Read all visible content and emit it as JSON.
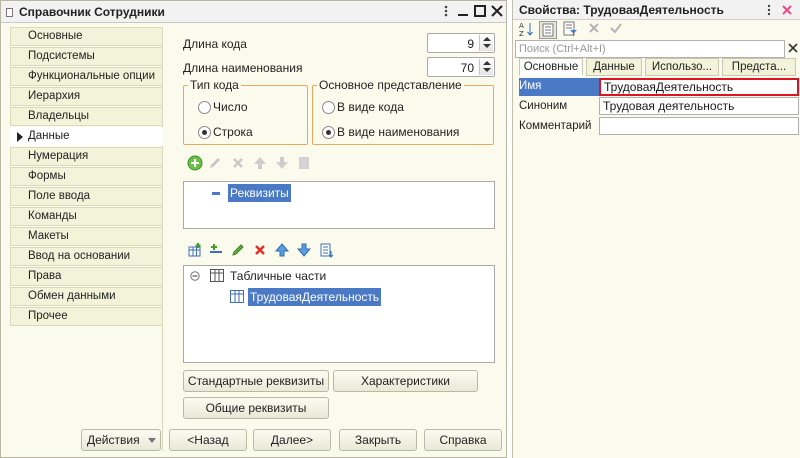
{
  "window": {
    "title": "Справочник Сотрудники"
  },
  "nav": {
    "items": [
      {
        "label": "Основные"
      },
      {
        "label": "Подсистемы"
      },
      {
        "label": "Функциональные опции"
      },
      {
        "label": "Иерархия"
      },
      {
        "label": "Владельцы"
      },
      {
        "label": "Данные"
      },
      {
        "label": "Нумерация"
      },
      {
        "label": "Формы"
      },
      {
        "label": "Поле ввода"
      },
      {
        "label": "Команды"
      },
      {
        "label": "Макеты"
      },
      {
        "label": "Ввод на основании"
      },
      {
        "label": "Права"
      },
      {
        "label": "Обмен данными"
      },
      {
        "label": "Прочее"
      }
    ],
    "active": "Данные"
  },
  "fields": {
    "code_length_label": "Длина кода",
    "code_length_value": "9",
    "name_length_label": "Длина наименования",
    "name_length_value": "70"
  },
  "code_type": {
    "title": "Тип кода",
    "options": [
      "Число",
      "Строка"
    ],
    "selected": "Строка"
  },
  "main_repr": {
    "title": "Основное представление",
    "options": [
      "В виде кода",
      "В виде наименования"
    ],
    "selected": "В виде наименования"
  },
  "attributes_tree": {
    "root": "Реквизиты"
  },
  "tables_tree": {
    "root": "Табличные части",
    "child": "ТрудоваяДеятельность"
  },
  "buttons": {
    "standard_attrs": "Стандартные реквизиты",
    "characteristics": "Характеристики",
    "common_attrs": "Общие реквизиты",
    "actions": "Действия",
    "back": "<Назад",
    "next": "Далее>",
    "close": "Закрыть",
    "help": "Справка"
  },
  "panel": {
    "title": "Свойства: ТрудоваяДеятельность",
    "search_placeholder": "Поиск (Ctrl+Alt+I)",
    "tabs": [
      "Основные",
      "Данные",
      "Использо...",
      "Предста..."
    ],
    "props": [
      {
        "label": "Имя",
        "value": "ТрудоваяДеятельность"
      },
      {
        "label": "Синоним",
        "value": "Трудовая деятельность"
      },
      {
        "label": "Комментарий",
        "value": ""
      }
    ]
  },
  "colors": {
    "window_bg": "#fbfbed",
    "selection": "#4a79c6",
    "group_border": "#e7a95e",
    "highlight_frame": "#e0141e"
  }
}
